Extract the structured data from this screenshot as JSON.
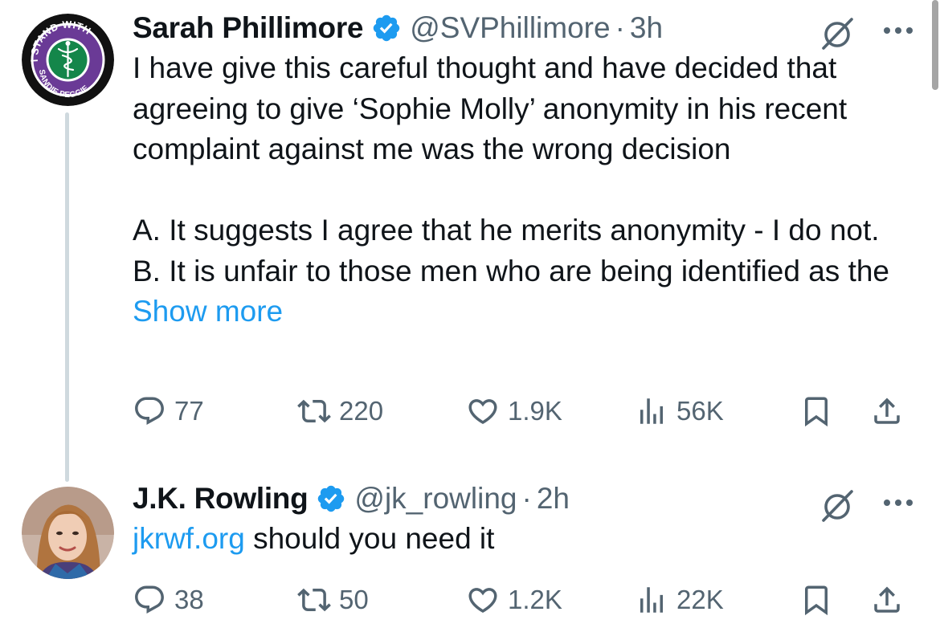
{
  "colors": {
    "text": "#0f1419",
    "secondary": "#536471",
    "link": "#1d9bf0",
    "verified": "#1d9bf0",
    "thread_line": "#cfd9de"
  },
  "tweets": [
    {
      "name": "Sarah Phillimore",
      "handle": "@SVPhillimore",
      "separator": "·",
      "time": "3h",
      "avatar": {
        "icon": "stand-with-sandie-peggie-badge",
        "ring_top": "I STAND WITH",
        "ring_bottom": "SANDIE PEGGIE"
      },
      "text": "I have give this careful thought and have decided that agreeing to give ‘Sophie Molly’ anonymity in his recent complaint against me was the wrong decision\n\nA. It suggests I agree that he merits anonymity - I do not.\nB. It is unfair to those men who are being identified as the ",
      "show_more": "Show more",
      "replies": "77",
      "retweets": "220",
      "likes": "1.9K",
      "views": "56K"
    },
    {
      "name": "J.K. Rowling",
      "handle": "@jk_rowling",
      "separator": "·",
      "time": "2h",
      "avatar": {
        "icon": "profile-photo"
      },
      "link": "jkrwf.org",
      "text": " should you need it",
      "replies": "38",
      "retweets": "50",
      "likes": "1.2K",
      "views": "22K"
    }
  ]
}
